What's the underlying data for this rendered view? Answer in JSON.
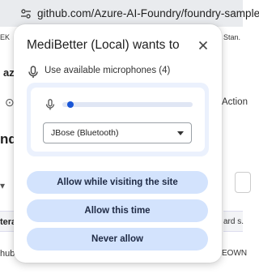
{
  "browser": {
    "url": "github.com/Azure-AI-Foundry/foundry-samples",
    "site_info_icon": "tune-icon"
  },
  "background": {
    "left_fragments": [
      "EK",
      "az",
      "ndr",
      "tera",
      "hub"
    ],
    "right_fragments": [
      "Stan.",
      "Action",
      "ard s.",
      "EOWN"
    ]
  },
  "popup": {
    "title": "MediBetter (Local) wants to",
    "close_icon": "close-icon",
    "permission_label": "Use available microphones (4)",
    "mic_level": 0.04,
    "selected_device": "JBose (Bluetooth)",
    "buttons": {
      "allow_visit": "Allow while visiting the site",
      "allow_once": "Allow this time",
      "never": "Never allow"
    }
  },
  "colors": {
    "accent": "#1a56d6",
    "button_bg": "#d3e3fd",
    "panel_bg": "#ebf1fd",
    "toolbar_bg": "#e9ebee"
  }
}
